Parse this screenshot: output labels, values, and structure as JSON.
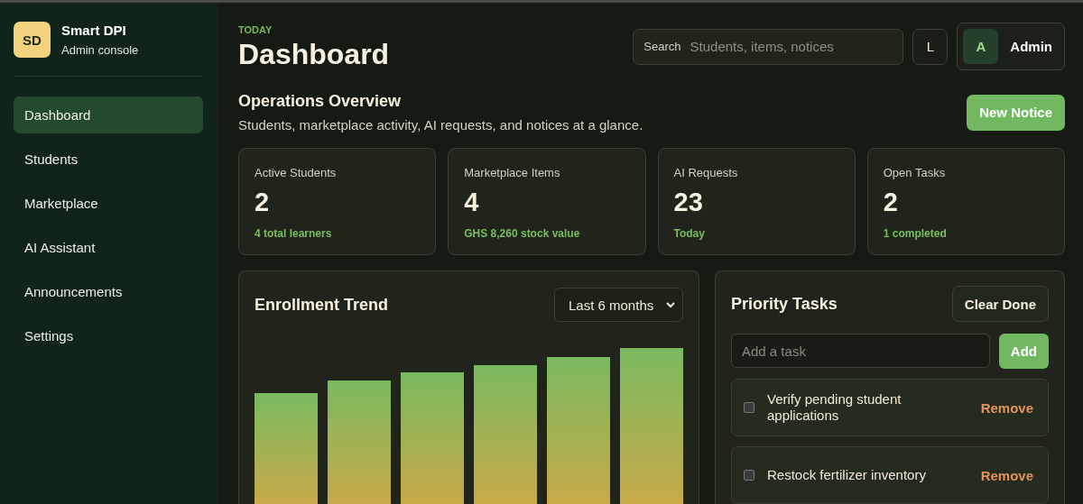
{
  "sidebar": {
    "logo": "SD",
    "title": "Smart DPI",
    "subtitle": "Admin console",
    "items": [
      {
        "label": "Dashboard",
        "selected": true
      },
      {
        "label": "Students",
        "selected": false
      },
      {
        "label": "Marketplace",
        "selected": false
      },
      {
        "label": "AI Assistant",
        "selected": false
      },
      {
        "label": "Announcements",
        "selected": false
      },
      {
        "label": "Settings",
        "selected": false
      }
    ]
  },
  "header": {
    "eyebrow": "TODAY",
    "title": "Dashboard",
    "search": {
      "label": "Search",
      "placeholder": "Students, items, notices"
    },
    "theme_button": "L",
    "user": {
      "avatar": "A",
      "name": "Admin"
    }
  },
  "overview": {
    "title": "Operations Overview",
    "subtitle": "Students, marketplace activity, AI requests, and notices at a glance.",
    "button": "New Notice"
  },
  "stats": [
    {
      "label": "Active Students",
      "value": "2",
      "note": "4 total learners"
    },
    {
      "label": "Marketplace Items",
      "value": "4",
      "note": "GHS 8,260 stock value"
    },
    {
      "label": "AI Requests",
      "value": "23",
      "note": "Today"
    },
    {
      "label": "Open Tasks",
      "value": "2",
      "note": "1 completed"
    }
  ],
  "enrollment": {
    "title": "Enrollment Trend",
    "range": "Last 6 months"
  },
  "tasks": {
    "title": "Priority Tasks",
    "clear_button": "Clear Done",
    "input_placeholder": "Add a task",
    "add_button": "Add",
    "items": [
      {
        "text": "Verify pending student applications",
        "checked": false,
        "action": "Remove"
      },
      {
        "text": "Restock fertilizer inventory",
        "checked": false,
        "action": "Remove"
      }
    ]
  }
}
